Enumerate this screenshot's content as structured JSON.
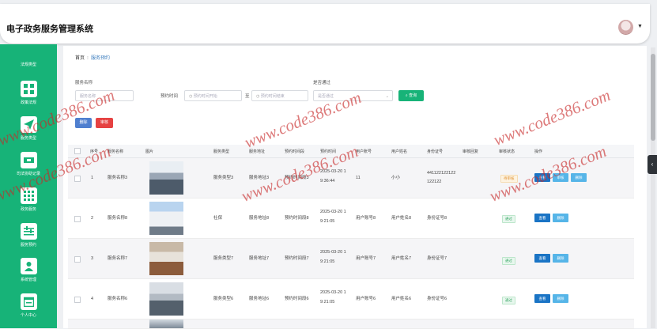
{
  "app": {
    "title": "电子政务服务管理系统"
  },
  "sidebar": {
    "items": [
      {
        "label": "法规类型",
        "icon": "list-icon"
      },
      {
        "label": "政策法规",
        "icon": "grid-icon"
      },
      {
        "label": "服务类型",
        "icon": "send-icon"
      },
      {
        "label": "司法协助记录",
        "icon": "ticket-icon"
      },
      {
        "label": "政务服务",
        "icon": "apps-icon"
      },
      {
        "label": "服务预约",
        "icon": "sliders-icon"
      },
      {
        "label": "系统管理",
        "icon": "person-icon"
      },
      {
        "label": "个人中心",
        "icon": "calendar-icon"
      }
    ]
  },
  "breadcrumb": {
    "home": "首页",
    "current": "服务预约"
  },
  "filters": {
    "service_name_label": "服务名称",
    "service_name_placeholder": "服务名称",
    "time_label": "预约时间",
    "time_start_placeholder": "预约时间开始",
    "time_to": "至",
    "time_end_placeholder": "预约时间结束",
    "approved_label": "是否通过",
    "approved_placeholder": "是否通过",
    "query_button": "查询"
  },
  "actions": {
    "delete": "删除",
    "audit": "审核"
  },
  "table": {
    "headers": [
      "序号",
      "服务名称",
      "图片",
      "服务类型",
      "服务地址",
      "预约时间段",
      "预约时间",
      "用户账号",
      "用户姓名",
      "身份证号",
      "审核回复",
      "审核状态",
      "操作"
    ],
    "rows": [
      {
        "no": "1",
        "name": "服务名称3",
        "type": "服务类型3",
        "address": "服务地址3",
        "slot": "预约时间段3",
        "time1": "2025-03-20 1",
        "time2": "9:36:44",
        "account": "11",
        "username": "小小",
        "id1": "441122122122",
        "id2": "122122",
        "reply": "",
        "status": "待审核",
        "buttons": [
          "查看",
          "审核",
          "删除"
        ]
      },
      {
        "no": "2",
        "name": "服务名称8",
        "type": "社保",
        "address": "服务地址8",
        "slot": "预约时间段8",
        "time1": "2025-03-20 1",
        "time2": "9:21:05",
        "account": "用户账号8",
        "username": "用户姓名8",
        "id1": "身份证号8",
        "id2": "",
        "reply": "",
        "status": "通过",
        "buttons": [
          "查看",
          "删除"
        ]
      },
      {
        "no": "3",
        "name": "服务名称7",
        "type": "服务类型7",
        "address": "服务地址7",
        "slot": "预约时间段7",
        "time1": "2025-03-20 1",
        "time2": "9:21:05",
        "account": "用户账号7",
        "username": "用户姓名7",
        "id1": "身份证号7",
        "id2": "",
        "reply": "",
        "status": "通过",
        "buttons": [
          "查看",
          "删除"
        ]
      },
      {
        "no": "4",
        "name": "服务名称6",
        "type": "服务类型6",
        "address": "服务地址6",
        "slot": "预约时间段6",
        "time1": "2025-03-20 1",
        "time2": "9:21:05",
        "account": "用户账号6",
        "username": "用户姓名6",
        "id1": "身份证号6",
        "id2": "",
        "reply": "",
        "status": "通过",
        "buttons": [
          "查看",
          "删除"
        ]
      }
    ]
  },
  "watermarks": [
    "www.code386.com",
    "www.code386.com",
    "www.code386.com",
    "www.code386.com",
    "www.code386.com",
    "www.code386.com"
  ],
  "colors": {
    "accent": "#17b378",
    "primary": "#1a74c5",
    "danger": "#e64242"
  }
}
